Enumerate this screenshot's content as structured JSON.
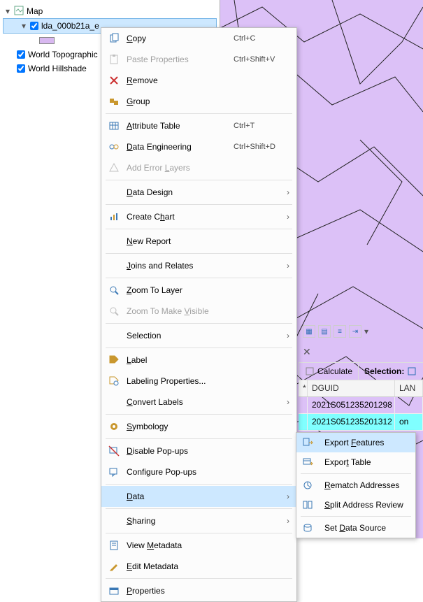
{
  "toc": {
    "root": "Map",
    "layers": [
      {
        "name": "lda_000b21a_e",
        "checked": true,
        "selected": true
      },
      {
        "swatch": true
      },
      {
        "name": "World Topographic",
        "checked": true
      },
      {
        "name": "World Hillshade",
        "checked": true
      }
    ]
  },
  "context_menu": {
    "items": [
      {
        "label": "Copy",
        "mn": "C",
        "shortcut": "Ctrl+C",
        "icon": "copy"
      },
      {
        "label": "Paste Properties",
        "mn": "",
        "shortcut": "Ctrl+Shift+V",
        "icon": "paste",
        "disabled": true
      },
      {
        "label": "Remove",
        "mn": "R",
        "shortcut": "",
        "icon": "remove"
      },
      {
        "label": "Group",
        "mn": "G",
        "shortcut": "",
        "icon": "group"
      },
      {
        "sep": true
      },
      {
        "label": "Attribute Table",
        "mn": "A",
        "shortcut": "Ctrl+T",
        "icon": "table"
      },
      {
        "label": "Data Engineering",
        "mn": "D",
        "shortcut": "Ctrl+Shift+D",
        "icon": "dataeng"
      },
      {
        "label": "Add Error Layers",
        "mn": "L",
        "shortcut": "",
        "icon": "error",
        "disabled": true
      },
      {
        "sep": true
      },
      {
        "label": "Data Design",
        "mn": "D",
        "shortcut": "",
        "submenu": true
      },
      {
        "sep": true
      },
      {
        "label": "Create Chart",
        "mn": "h",
        "shortcut": "",
        "icon": "chart",
        "submenu": true
      },
      {
        "sep": true
      },
      {
        "label": "New Report",
        "mn": "N",
        "shortcut": ""
      },
      {
        "sep": true
      },
      {
        "label": "Joins and Relates",
        "mn": "J",
        "shortcut": "",
        "submenu": true
      },
      {
        "sep": true
      },
      {
        "label": "Zoom To Layer",
        "mn": "Z",
        "shortcut": "",
        "icon": "zoom"
      },
      {
        "label": "Zoom To Make Visible",
        "mn": "V",
        "shortcut": "",
        "icon": "zoom",
        "disabled": true
      },
      {
        "sep": true
      },
      {
        "label": "Selection",
        "mn": "",
        "shortcut": "",
        "submenu": true
      },
      {
        "sep": true
      },
      {
        "label": "Label",
        "mn": "L",
        "shortcut": "",
        "icon": "label"
      },
      {
        "label": "Labeling Properties...",
        "mn": "",
        "shortcut": "",
        "icon": "labelprop"
      },
      {
        "label": "Convert Labels",
        "mn": "C",
        "shortcut": "",
        "submenu": true
      },
      {
        "sep": true
      },
      {
        "label": "Symbology",
        "mn": "S",
        "shortcut": "",
        "icon": "symbology"
      },
      {
        "sep": true
      },
      {
        "label": "Disable Pop-ups",
        "mn": "D",
        "shortcut": "",
        "icon": "popupoff"
      },
      {
        "label": "Configure Pop-ups",
        "mn": "",
        "shortcut": "",
        "icon": "popup"
      },
      {
        "sep": true
      },
      {
        "label": "Data",
        "mn": "D",
        "shortcut": "",
        "submenu": true,
        "highlighted": true
      },
      {
        "sep": true
      },
      {
        "label": "Sharing",
        "mn": "S",
        "shortcut": "",
        "submenu": true
      },
      {
        "sep": true
      },
      {
        "label": "View Metadata",
        "mn": "M",
        "shortcut": "",
        "icon": "metaview"
      },
      {
        "label": "Edit Metadata",
        "mn": "E",
        "shortcut": "",
        "icon": "metaedit"
      },
      {
        "sep": true
      },
      {
        "label": "Properties",
        "mn": "P",
        "shortcut": "",
        "icon": "props"
      }
    ]
  },
  "submenu_data": {
    "items": [
      {
        "label": "Export Features",
        "mn": "F",
        "icon": "export",
        "highlighted": true
      },
      {
        "label": "Export Table",
        "mn": "T",
        "icon": "exporttable"
      },
      {
        "sep": true
      },
      {
        "label": "Rematch Addresses",
        "mn": "R",
        "icon": "rematch"
      },
      {
        "label": "Split Address Review",
        "mn": "S",
        "icon": "split"
      },
      {
        "sep": true
      },
      {
        "label": "Set Data Source",
        "mn": "D",
        "icon": "datasource"
      }
    ]
  },
  "toolbar": {
    "calculate": "Calculate",
    "selection": "Selection:"
  },
  "table": {
    "col_dguid": "DGUID",
    "col_lan": "LAN",
    "rows": [
      {
        "dguid": "2021S051235201298",
        "on": ""
      },
      {
        "dguid": "2021S051235201312",
        "on": "on",
        "hl": true
      }
    ]
  },
  "colors": {
    "map_fill": "#dcc1f7",
    "map_line": "#222",
    "highlight": "#cde8ff",
    "highlight_table": "#80ffff"
  }
}
